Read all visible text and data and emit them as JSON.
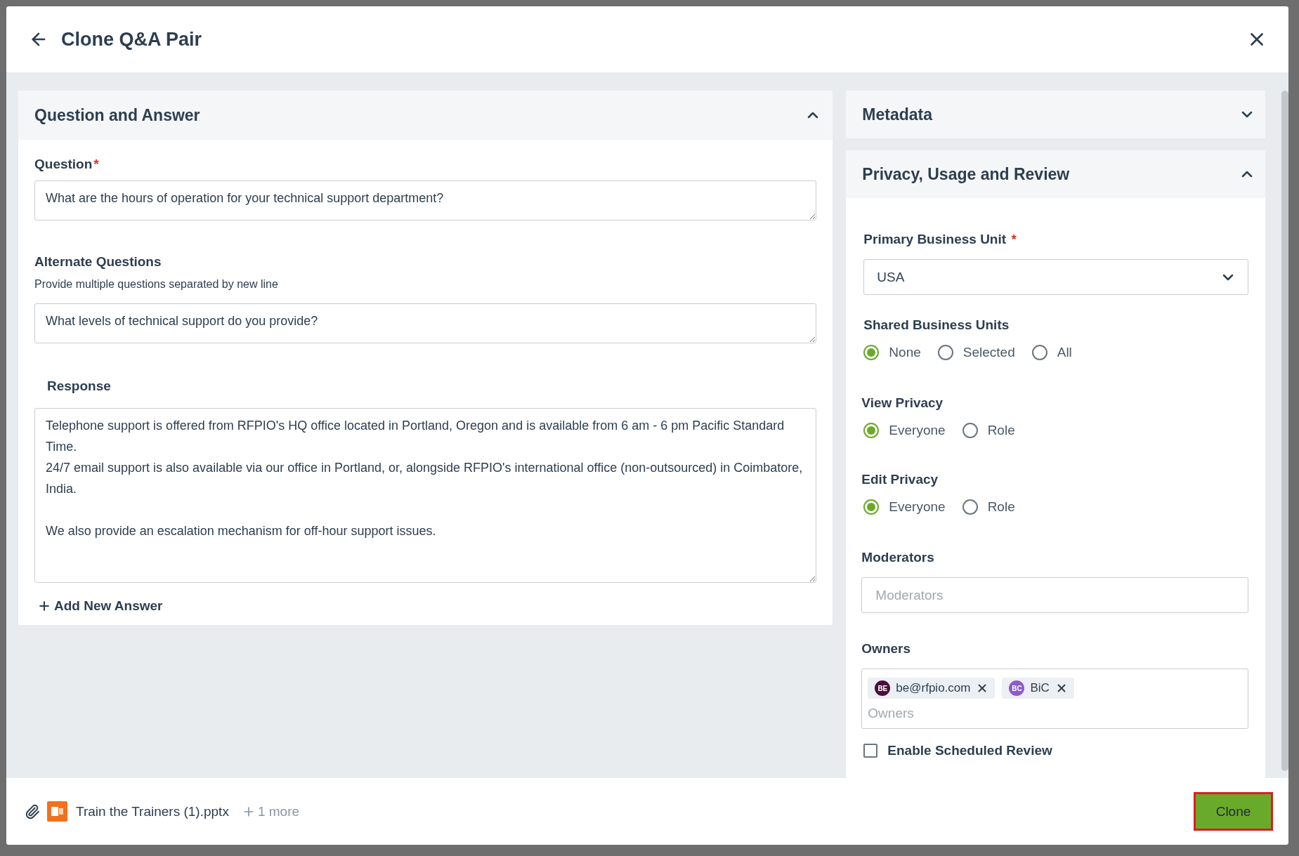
{
  "dialog": {
    "title": "Clone Q&A Pair"
  },
  "qa_section": {
    "title": "Question and Answer",
    "expanded": true,
    "question": {
      "label": "Question",
      "required_mark": "*",
      "value": "What are the hours of operation for your technical support department?"
    },
    "alternate": {
      "label": "Alternate Questions",
      "hint": "Provide multiple questions separated by new line",
      "value": "What levels of technical support do you provide?"
    },
    "response": {
      "label": "Response",
      "value": "Telephone support is offered from RFPIO's HQ office located in Portland, Oregon and is available from 6 am - 6 pm Pacific Standard Time.\n24/7 email support is also available via our office in Portland, or, alongside RFPIO's international office (non-outsourced) in Coimbatore, India.\n\nWe also provide an escalation mechanism for off-hour support issues."
    },
    "add_answer": "Add New Answer"
  },
  "metadata": {
    "title": "Metadata",
    "expanded": false
  },
  "privacy": {
    "title": "Privacy, Usage and Review",
    "expanded": true,
    "primary_bu": {
      "label": "Primary Business Unit",
      "required_mark": "*",
      "value": "USA"
    },
    "shared_bu": {
      "label": "Shared Business Units",
      "options": [
        {
          "label": "None",
          "selected": true
        },
        {
          "label": "Selected",
          "selected": false
        },
        {
          "label": "All",
          "selected": false
        }
      ]
    },
    "view_privacy": {
      "label": "View Privacy",
      "options": [
        {
          "label": "Everyone",
          "selected": true
        },
        {
          "label": "Role",
          "selected": false
        }
      ]
    },
    "edit_privacy": {
      "label": "Edit Privacy",
      "options": [
        {
          "label": "Everyone",
          "selected": true
        },
        {
          "label": "Role",
          "selected": false
        }
      ]
    },
    "moderators": {
      "label": "Moderators",
      "placeholder": "Moderators"
    },
    "owners": {
      "label": "Owners",
      "placeholder": "Owners",
      "tags": [
        {
          "initials": "BE",
          "name": "be@rfpio.com",
          "color": "#4a0e3d"
        },
        {
          "initials": "BC",
          "name": "BiC",
          "color": "#8e5bc8"
        }
      ]
    },
    "scheduled_review": {
      "label": "Enable Scheduled Review",
      "checked": false
    }
  },
  "footer": {
    "attachment": "Train the Trainers (1).pptx",
    "more": "1 more",
    "button": "Clone"
  }
}
